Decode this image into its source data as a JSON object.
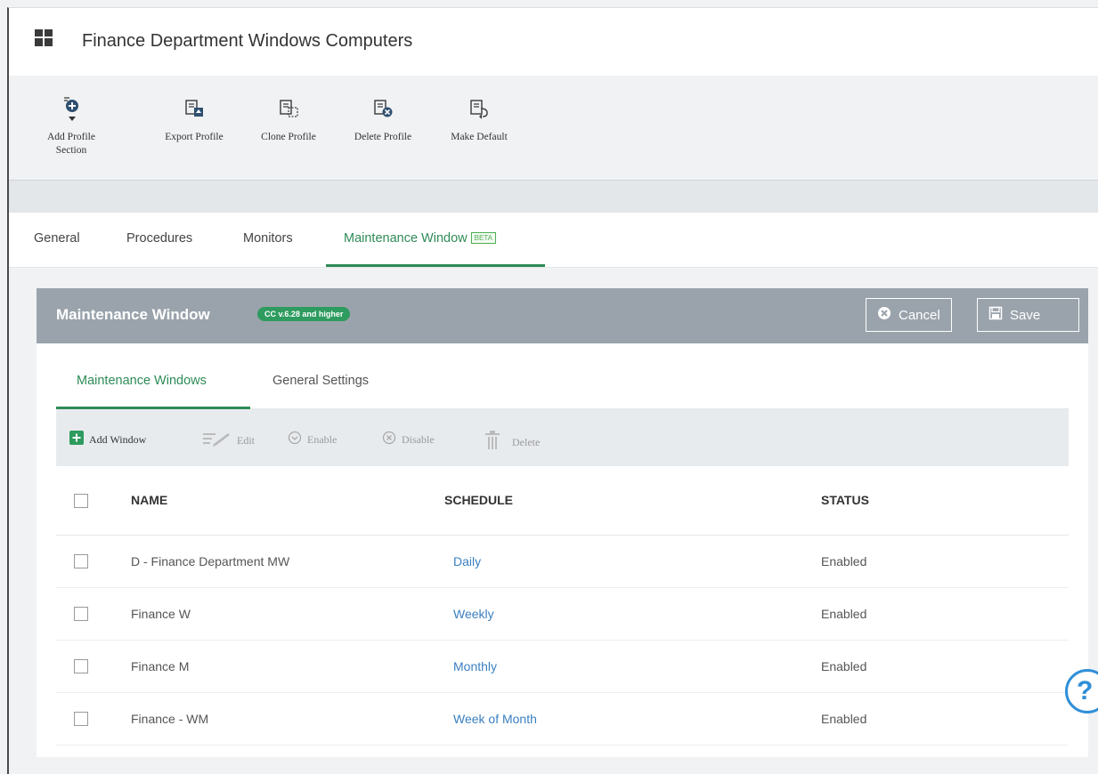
{
  "window": {
    "title": "Finance Department Windows Computers"
  },
  "toolbar": {
    "items": [
      {
        "label_line1": "Add Profile",
        "label_line2": "Section",
        "icon": "add-profile-section-icon"
      },
      {
        "label": "Export Profile",
        "icon": "export-profile-icon"
      },
      {
        "label": "Clone Profile",
        "icon": "clone-profile-icon"
      },
      {
        "label": "Delete Profile",
        "icon": "delete-profile-icon"
      },
      {
        "label": "Make Default",
        "icon": "make-default-icon"
      }
    ]
  },
  "tabs": {
    "general": "General",
    "procedures": "Procedures",
    "monitors": "Monitors",
    "maintenance": "Maintenance Window",
    "beta_badge": "BETA"
  },
  "panel": {
    "title": "Maintenance Window",
    "version_badge": "CC v.6.28 and higher",
    "cancel_label": "Cancel",
    "save_label": "Save"
  },
  "subtabs": {
    "maintenance_windows": "Maintenance Windows",
    "general_settings": "General Settings"
  },
  "actions": {
    "add_window": "Add Window",
    "edit": "Edit",
    "enable": "Enable",
    "disable": "Disable",
    "delete": "Delete"
  },
  "table": {
    "columns": {
      "name": "NAME",
      "schedule": "SCHEDULE",
      "status": "STATUS"
    },
    "rows": [
      {
        "name": "D - Finance Department MW",
        "schedule": "Daily",
        "status": "Enabled"
      },
      {
        "name": "Finance W",
        "schedule": "Weekly",
        "status": "Enabled"
      },
      {
        "name": "Finance M",
        "schedule": "Monthly",
        "status": "Enabled"
      },
      {
        "name": "Finance - WM",
        "schedule": "Week of Month",
        "status": "Enabled"
      }
    ]
  },
  "help": {
    "label": "?"
  },
  "colors": {
    "accent_green": "#2e8b57",
    "link_blue": "#3a7fc1",
    "header_gray": "#9aa3ab"
  }
}
